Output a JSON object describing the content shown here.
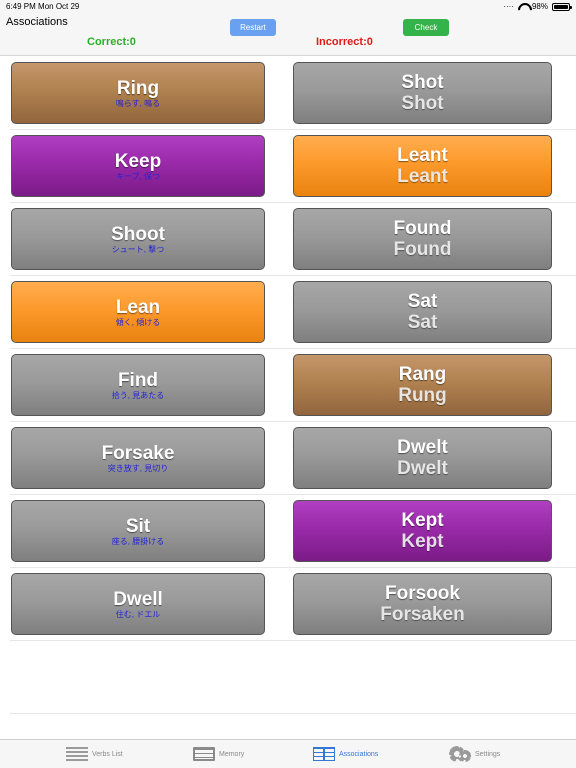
{
  "status": {
    "time": "6:49 PM",
    "date": "Mon Oct 29",
    "battery": "98%"
  },
  "header": {
    "title": "Associations",
    "restart_label": "Restart",
    "check_label": "Check",
    "correct_text": "Correct:0",
    "incorrect_text": "Incorrect:0",
    "correct_color": "#2cae2c",
    "incorrect_color": "#e01919"
  },
  "rows": [
    {
      "left": {
        "word": "Ring",
        "meaning": "鳴らす, 鳴る",
        "color": "brown"
      },
      "right": {
        "past": "Shot",
        "participle": "Shot",
        "color": "gray"
      }
    },
    {
      "left": {
        "word": "Keep",
        "meaning": "キープ, 保つ",
        "color": "purple"
      },
      "right": {
        "past": "Leant",
        "participle": "Leant",
        "color": "orange"
      }
    },
    {
      "left": {
        "word": "Shoot",
        "meaning": "シュート, 撃つ",
        "color": "gray"
      },
      "right": {
        "past": "Found",
        "participle": "Found",
        "color": "gray"
      }
    },
    {
      "left": {
        "word": "Lean",
        "meaning": "傾く, 傾ける",
        "color": "orange"
      },
      "right": {
        "past": "Sat",
        "participle": "Sat",
        "color": "gray"
      }
    },
    {
      "left": {
        "word": "Find",
        "meaning": "拾う, 見あたる",
        "color": "gray"
      },
      "right": {
        "past": "Rang",
        "participle": "Rung",
        "color": "brown"
      }
    },
    {
      "left": {
        "word": "Forsake",
        "meaning": "突き放す, 見切り",
        "color": "gray"
      },
      "right": {
        "past": "Dwelt",
        "participle": "Dwelt",
        "color": "gray"
      }
    },
    {
      "left": {
        "word": "Sit",
        "meaning": "座る, 腰掛ける",
        "color": "gray"
      },
      "right": {
        "past": "Kept",
        "participle": "Kept",
        "color": "purple"
      }
    },
    {
      "left": {
        "word": "Dwell",
        "meaning": "住む, ドエル",
        "color": "gray"
      },
      "right": {
        "past": "Forsook",
        "participle": "Forsaken",
        "color": "gray"
      }
    }
  ],
  "tabbar": {
    "tabs": [
      {
        "label": "Verbs List",
        "icon": "list-icon",
        "active": false
      },
      {
        "label": "Memory",
        "icon": "memory-icon",
        "active": false
      },
      {
        "label": "Associations",
        "icon": "associations-icon",
        "active": true
      },
      {
        "label": "Settings",
        "icon": "gear-icon",
        "active": false
      }
    ]
  },
  "colors": {
    "gray": "#9a9a9a",
    "brown": "#b08250",
    "purple": "#9a2aa9",
    "orange": "#fc9a2c",
    "active_tab": "#3478d6",
    "inactive_tab": "#8a8a8a",
    "restart_button": "#6aa0f0",
    "check_button": "#34b34a",
    "meaning_text": "#2323d6"
  }
}
